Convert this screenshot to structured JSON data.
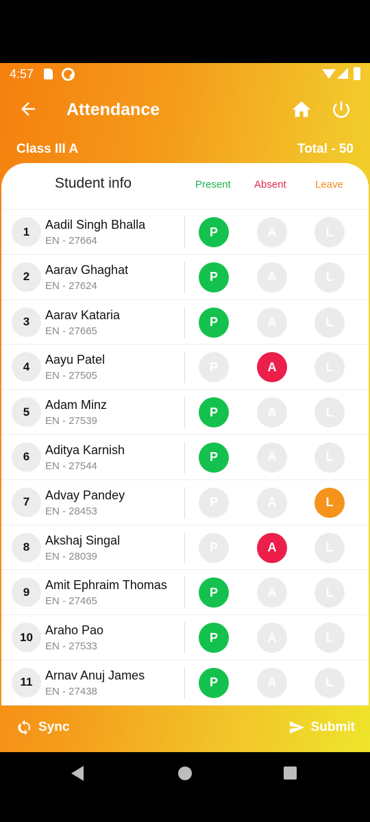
{
  "status_bar": {
    "time": "4:57"
  },
  "header": {
    "title": "Attendance"
  },
  "class_info": {
    "class_name": "Class III A",
    "total": "Total - 50"
  },
  "columns": {
    "student_info": "Student info",
    "present": "Present",
    "absent": "Absent",
    "leave": "Leave"
  },
  "button_labels": {
    "present": "P",
    "absent": "A",
    "leave": "L"
  },
  "status_colors": {
    "present": "#14c14e",
    "absent": "#ec1e4b",
    "leave": "#f5931c",
    "inactive": "#ebebeb"
  },
  "students": [
    {
      "num": "1",
      "name": "Aadil Singh Bhalla",
      "enroll": "EN - 27664",
      "status": "present"
    },
    {
      "num": "2",
      "name": "Aarav Ghaghat",
      "enroll": "EN - 27624",
      "status": "present"
    },
    {
      "num": "3",
      "name": "Aarav Kataria",
      "enroll": "EN - 27665",
      "status": "present"
    },
    {
      "num": "4",
      "name": "Aayu Patel",
      "enroll": "EN - 27505",
      "status": "absent"
    },
    {
      "num": "5",
      "name": "Adam Minz",
      "enroll": "EN - 27539",
      "status": "present"
    },
    {
      "num": "6",
      "name": "Aditya Karnish",
      "enroll": "EN - 27544",
      "status": "present"
    },
    {
      "num": "7",
      "name": "Advay Pandey",
      "enroll": "EN - 28453",
      "status": "leave"
    },
    {
      "num": "8",
      "name": "Akshaj Singal",
      "enroll": "EN - 28039",
      "status": "absent"
    },
    {
      "num": "9",
      "name": "Amit Ephraim Thomas",
      "enroll": "EN - 27465",
      "status": "present"
    },
    {
      "num": "10",
      "name": "Araho Pao",
      "enroll": "EN - 27533",
      "status": "present"
    },
    {
      "num": "11",
      "name": "Arnav Anuj James",
      "enroll": "EN - 27438",
      "status": "present"
    }
  ],
  "footer": {
    "sync_label": "Sync",
    "submit_label": "Submit"
  },
  "icons": {
    "back": "arrow-left-icon",
    "home": "home-icon",
    "power": "power-icon",
    "sync": "sync-icon",
    "submit": "send-icon"
  }
}
